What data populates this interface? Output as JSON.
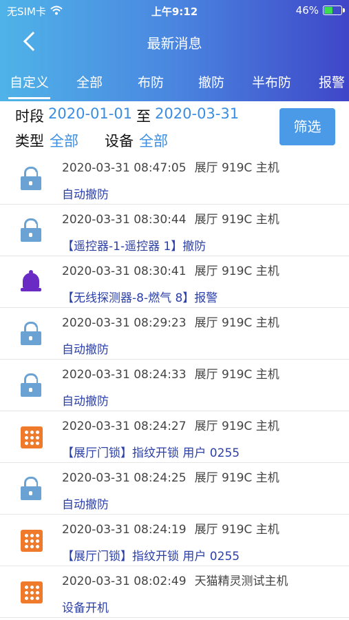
{
  "status": {
    "carrier": "无SIM卡",
    "time": "上午9:12",
    "battery": "46%",
    "battery_level": 0.46
  },
  "nav": {
    "title": "最新消息"
  },
  "tabs": [
    "自定义",
    "全部",
    "布防",
    "撤防",
    "半布防",
    "报警"
  ],
  "filter": {
    "period_label": "时段",
    "start_date": "2020-01-01",
    "to_label": "至",
    "end_date": "2020-03-31",
    "type_label": "类型",
    "type_value": "全部",
    "device_label": "设备",
    "device_value": "全部",
    "button": "筛选"
  },
  "messages": [
    {
      "icon": "lock-open-icon",
      "time": "2020-03-31 08:47:05",
      "device": "展厅 919C 主机",
      "text": "自动撤防"
    },
    {
      "icon": "lock-open-icon",
      "time": "2020-03-31 08:30:44",
      "device": "展厅 919C 主机",
      "text": "【遥控器-1-遥控器 1】撤防"
    },
    {
      "icon": "bell-icon",
      "time": "2020-03-31 08:30:41",
      "device": "展厅 919C 主机",
      "text": "【无线探测器-8-燃气 8】报警"
    },
    {
      "icon": "lock-open-icon",
      "time": "2020-03-31 08:29:23",
      "device": "展厅 919C 主机",
      "text": "自动撤防"
    },
    {
      "icon": "lock-open-icon",
      "time": "2020-03-31 08:24:33",
      "device": "展厅 919C 主机",
      "text": "自动撤防"
    },
    {
      "icon": "keypad-icon",
      "time": "2020-03-31 08:24:27",
      "device": "展厅 919C 主机",
      "text": "【展厅门锁】指纹开锁 用户 0255"
    },
    {
      "icon": "lock-open-icon",
      "time": "2020-03-31 08:24:25",
      "device": "展厅 919C 主机",
      "text": "自动撤防"
    },
    {
      "icon": "keypad-icon",
      "time": "2020-03-31 08:24:19",
      "device": "展厅 919C 主机",
      "text": "【展厅门锁】指纹开锁 用户 0255"
    },
    {
      "icon": "keypad-icon",
      "time": "2020-03-31 08:02:49",
      "device": "天猫精灵测试主机",
      "text": "设备开机"
    }
  ]
}
